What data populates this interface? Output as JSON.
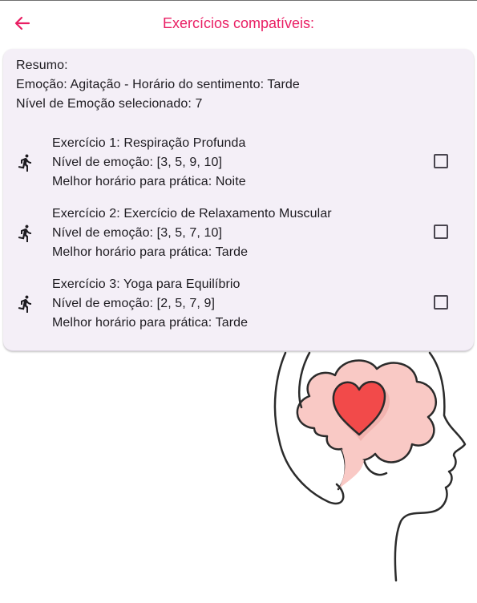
{
  "app_bar": {
    "title": "Exercícios compatíveis:",
    "accent_color": "#e91e63",
    "back_icon": "arrow-left-icon"
  },
  "summary": {
    "heading": "Resumo:",
    "emotion_line": "Emoção: Agitação - Horário do sentimento: Tarde",
    "level_line": "Nível de Emoção selecionado: 7"
  },
  "exercises": [
    {
      "icon": "running-person-icon",
      "title": "Exercício 1: Respiração Profunda",
      "levels": "Nível de emoção: [3, 5, 9, 10]",
      "best_time": "Melhor horário para prática: Noite",
      "checked": false
    },
    {
      "icon": "running-person-icon",
      "title": "Exercício 2: Exercício de Relaxamento Muscular",
      "levels": "Nível de emoção: [3, 5, 7, 10]",
      "best_time": "Melhor horário para prática: Tarde",
      "checked": false
    },
    {
      "icon": "running-person-icon",
      "title": "Exercício 3: Yoga para Equilíbrio",
      "levels": "Nível de emoção: [2, 5, 7, 9]",
      "best_time": "Melhor horário para prática: Tarde",
      "checked": false
    }
  ],
  "illustration": {
    "icon": "head-brain-heart-illustration",
    "brain_color": "#f9c9c5",
    "heart_color": "#f24a4a"
  }
}
